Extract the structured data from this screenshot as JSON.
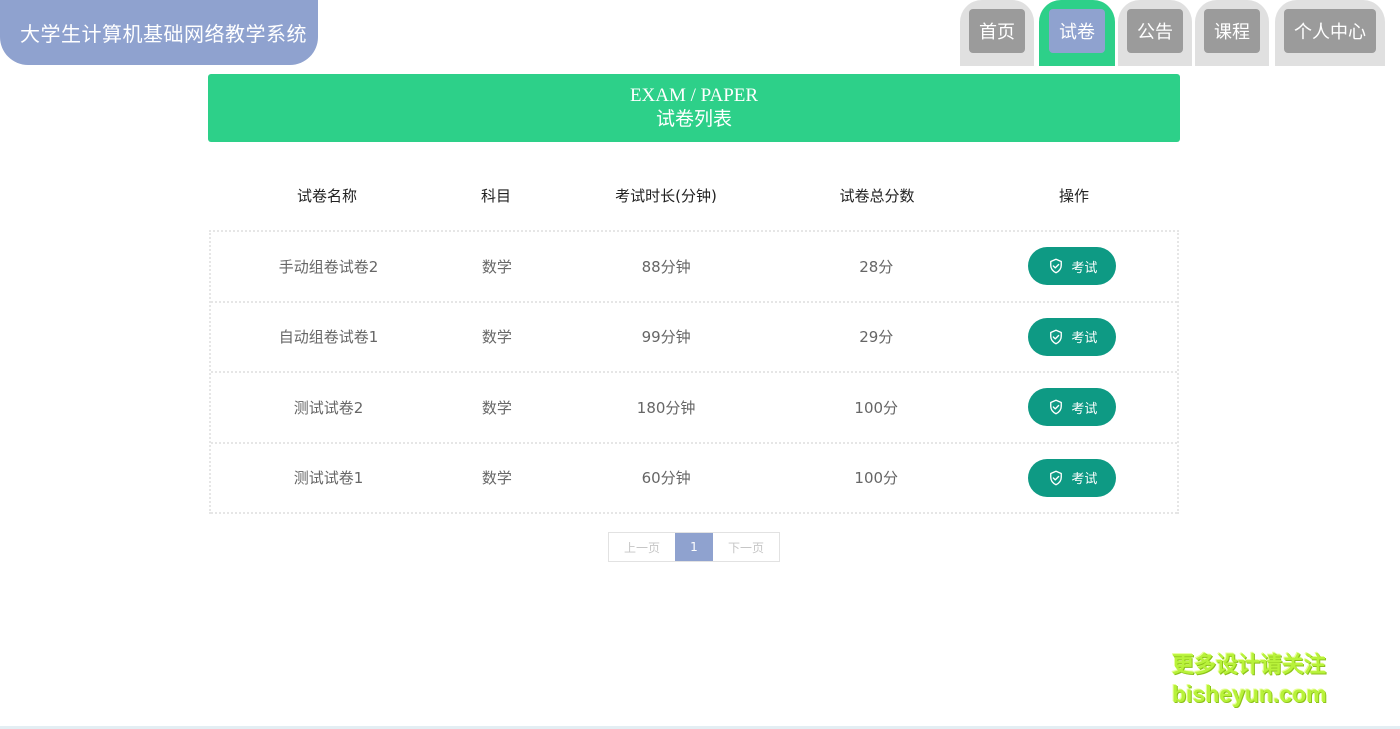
{
  "header": {
    "site_title": "大学生计算机基础网络教学系统",
    "nav": [
      {
        "label": "首页",
        "active": false
      },
      {
        "label": "试卷",
        "active": true
      },
      {
        "label": "公告",
        "active": false
      },
      {
        "label": "课程",
        "active": false
      },
      {
        "label": "个人中心",
        "active": false
      }
    ]
  },
  "banner": {
    "title_en": "EXAM / PAPER",
    "title_cn": "试卷列表"
  },
  "table": {
    "headers": [
      "试卷名称",
      "科目",
      "考试时长(分钟)",
      "试卷总分数",
      "操作"
    ],
    "rows": [
      {
        "name": "手动组卷试卷2",
        "subject": "数学",
        "duration": "88分钟",
        "score": "28分",
        "action": "考试"
      },
      {
        "name": "自动组卷试卷1",
        "subject": "数学",
        "duration": "99分钟",
        "score": "29分",
        "action": "考试"
      },
      {
        "name": "测试试卷2",
        "subject": "数学",
        "duration": "180分钟",
        "score": "100分",
        "action": "考试"
      },
      {
        "name": "测试试卷1",
        "subject": "数学",
        "duration": "60分钟",
        "score": "100分",
        "action": "考试"
      }
    ]
  },
  "pagination": {
    "prev": "上一页",
    "current": "1",
    "next": "下一页"
  },
  "watermark": {
    "line1": "更多设计请关注",
    "line2": "bisheyun.com"
  },
  "colors": {
    "brand_purple": "#8fa2cf",
    "brand_green": "#2dd089",
    "button_teal": "#0e9a84"
  }
}
